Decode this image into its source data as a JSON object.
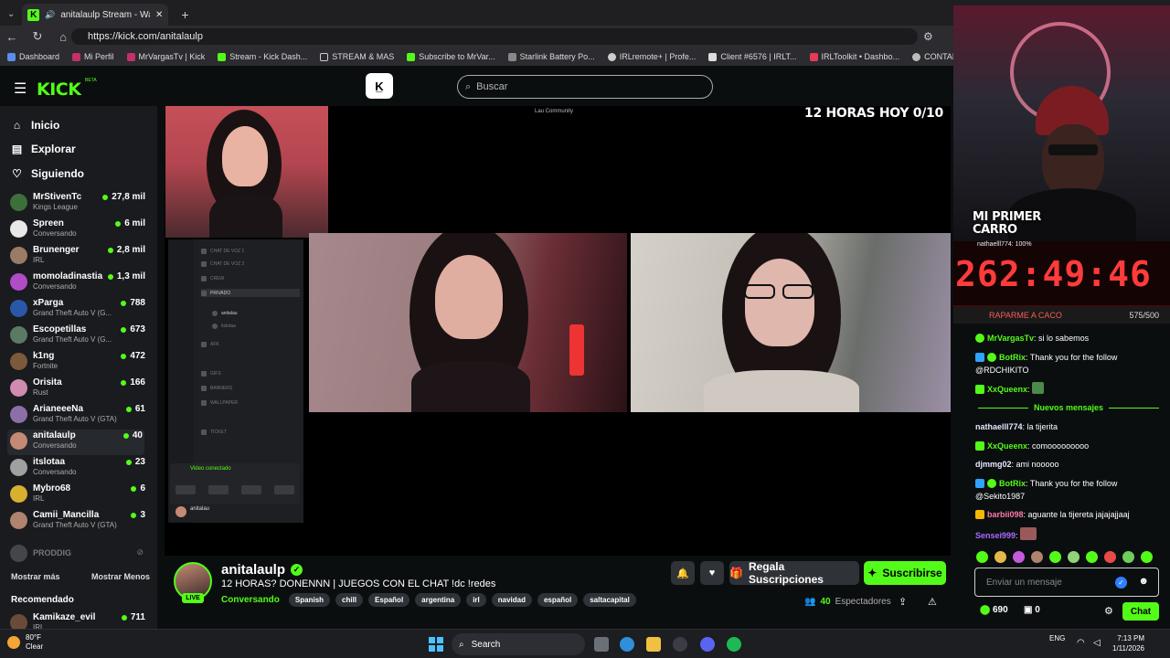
{
  "browser": {
    "tab_title": "anitalaulp Stream - Watch Liv",
    "url": "https://kick.com/anitalaulp",
    "bookmarks": [
      "Dashboard",
      "Mi Perfil",
      "MrVargasTv | Kick",
      "Stream - Kick Dash...",
      "STREAM & MAS",
      "Subscribe to MrVar...",
      "Starlink Battery Po...",
      "IRLremote+ | Profe...",
      "Client #6576 | IRLT...",
      "IRLToolkit • Dashbo...",
      "CONTADOR"
    ]
  },
  "header": {
    "logo": "KICK",
    "beta": "BETA",
    "search_placeholder": "Buscar"
  },
  "nav": {
    "home": "Inicio",
    "explore": "Explorar",
    "following": "Siguiendo"
  },
  "channels": [
    {
      "name": "MrStivenTc",
      "category": "Kings League",
      "viewers": "27,8 mil"
    },
    {
      "name": "Spreen",
      "category": "Conversando",
      "viewers": "6 mil"
    },
    {
      "name": "Brunenger",
      "category": "IRL",
      "viewers": "2,8 mil"
    },
    {
      "name": "momoladinastia",
      "category": "Conversando",
      "viewers": "1,3 mil"
    },
    {
      "name": "xParga",
      "category": "Grand Theft Auto V (G...",
      "viewers": "788"
    },
    {
      "name": "Escopetillas",
      "category": "Grand Theft Auto V (G...",
      "viewers": "673"
    },
    {
      "name": "k1ng",
      "category": "Fortnite",
      "viewers": "472"
    },
    {
      "name": "Orisita",
      "category": "Rust",
      "viewers": "166"
    },
    {
      "name": "ArianeeeNa",
      "category": "Grand Theft Auto V (GTA)",
      "viewers": "61"
    },
    {
      "name": "anitalaulp",
      "category": "Conversando",
      "viewers": "40"
    },
    {
      "name": "itslotaa",
      "category": "Conversando",
      "viewers": "23"
    },
    {
      "name": "Mybro68",
      "category": "IRL",
      "viewers": "6"
    },
    {
      "name": "Camii_Mancilla",
      "category": "Grand Theft Auto V (GTA)",
      "viewers": "3"
    }
  ],
  "offline_channel": "PRODDIG",
  "show_more": "Mostrar más",
  "show_less": "Mostrar Menos",
  "recommended_label": "Recomendado",
  "recommended": [
    {
      "name": "Kamikaze_evil",
      "category": "IRL",
      "viewers": "711"
    }
  ],
  "stream": {
    "overlay_title": "12 HORAS HOY 0/10",
    "community": "Lau Community",
    "channel_name": "anitalaulp",
    "title": "12 HORAS? DONENNN | JUEGOS CON EL CHAT  !dc !redes",
    "category": "Conversando",
    "tags": [
      "Spanish",
      "chill",
      "Español",
      "argentina",
      "irl",
      "navidad",
      "español",
      "saltacapital"
    ],
    "viewers": "40",
    "viewers_label": "Espectadores",
    "gift_label": "Regala Suscripciones",
    "subscribe_label": "Suscribirse",
    "live_label": "LIVE"
  },
  "overlay": {
    "primer_carro": "MI PRIMER CARRO",
    "sub_line": "nathaelll774: 100%",
    "timer": "262:49:46",
    "goal_label": "RAPARME A CACO",
    "goal_count": "575/500"
  },
  "chat": {
    "messages": [
      {
        "user": "MrVargasTv",
        "text": "si lo sabemos",
        "color": "#53fc18"
      },
      {
        "user": "BotRix",
        "text": "Thank you for the follow @RDCHIKITO",
        "color": "#53fc18"
      },
      {
        "user": "XxQueenx",
        "text": "",
        "color": "#53fc18"
      },
      {
        "user": "nathaelll774",
        "text": "la tijerita",
        "color": "#e8e8ff"
      },
      {
        "user": "XxQueenx",
        "text": "comooooooooo",
        "color": "#53fc18"
      },
      {
        "user": "djmmg02",
        "text": "ami nooooo",
        "color": "#e8e8ff"
      },
      {
        "user": "BotRix",
        "text": "Thank you for the follow @Sekito1987",
        "color": "#53fc18"
      },
      {
        "user": "barbii098",
        "text": "aguante la tijereta jajajajjaaj",
        "color": "#ff7aa8"
      },
      {
        "user": "Sensei999",
        "text": "",
        "color": "#a86bff"
      }
    ],
    "new_messages": "Nuevos mensajes",
    "input_placeholder": "Enviar un mensaje",
    "points": "690",
    "gifts": "0",
    "send_label": "Chat"
  },
  "taskbar": {
    "temp": "80°F",
    "condition": "Clear",
    "search": "Search",
    "lang": "ENG",
    "time": "7:13 PM",
    "date": "1/11/2026"
  },
  "colors": {
    "accent": "#53fc18",
    "background": "#0b0e0f",
    "sidebar": "#191b1f",
    "timer": "#ff3b3b"
  }
}
